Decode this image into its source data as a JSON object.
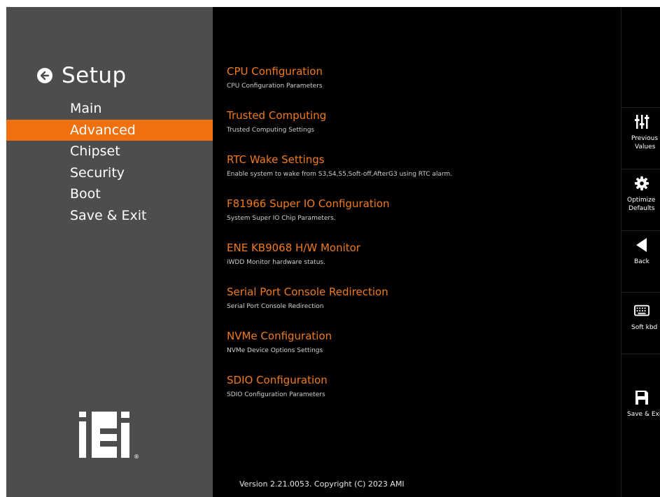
{
  "sidebar": {
    "title": "Setup",
    "nav": [
      {
        "label": "Main"
      },
      {
        "label": "Advanced"
      },
      {
        "label": "Chipset"
      },
      {
        "label": "Security"
      },
      {
        "label": "Boot"
      },
      {
        "label": "Save & Exit"
      }
    ],
    "active_nav": "Advanced",
    "logo_text": "iEi"
  },
  "menu": [
    {
      "title": "CPU Configuration",
      "desc": "CPU Configuration Parameters"
    },
    {
      "title": "Trusted Computing",
      "desc": "Trusted Computing Settings"
    },
    {
      "title": "RTC Wake Settings",
      "desc": "Enable system to wake from S3,S4,S5,Soft-off,AfterG3 using RTC alarm."
    },
    {
      "title": "F81966 Super IO Configuration",
      "desc": "System Super IO Chip Parameters."
    },
    {
      "title": "ENE KB9068 H/W Monitor",
      "desc": "iWDD Monitor hardware status."
    },
    {
      "title": "Serial Port Console Redirection",
      "desc": "Serial Port Console Redirection"
    },
    {
      "title": "NVMe Configuration",
      "desc": "NVMe Device Options Settings"
    },
    {
      "title": "SDIO Configuration",
      "desc": "SDIO Configuration Parameters"
    }
  ],
  "footer": "Version 2.21.0053. Copyright (C) 2023 AMI",
  "right_panel": [
    {
      "label1": "Previous",
      "label2": "Values",
      "icon": "sliders-icon"
    },
    {
      "label1": "Optimize",
      "label2": "Defaults",
      "icon": "gear-icon"
    },
    {
      "label1": "Back",
      "label2": "",
      "icon": "back-triangle-icon"
    },
    {
      "label1": "Soft kbd",
      "label2": "",
      "icon": "keyboard-icon"
    },
    {
      "label1": "Save & Exi",
      "label2": "",
      "icon": "floppy-disk-icon"
    }
  ],
  "colors": {
    "accent": "#f07010",
    "sidebar_bg": "#4d4d4d",
    "background": "#000000",
    "menu_title": "#f07a18"
  }
}
